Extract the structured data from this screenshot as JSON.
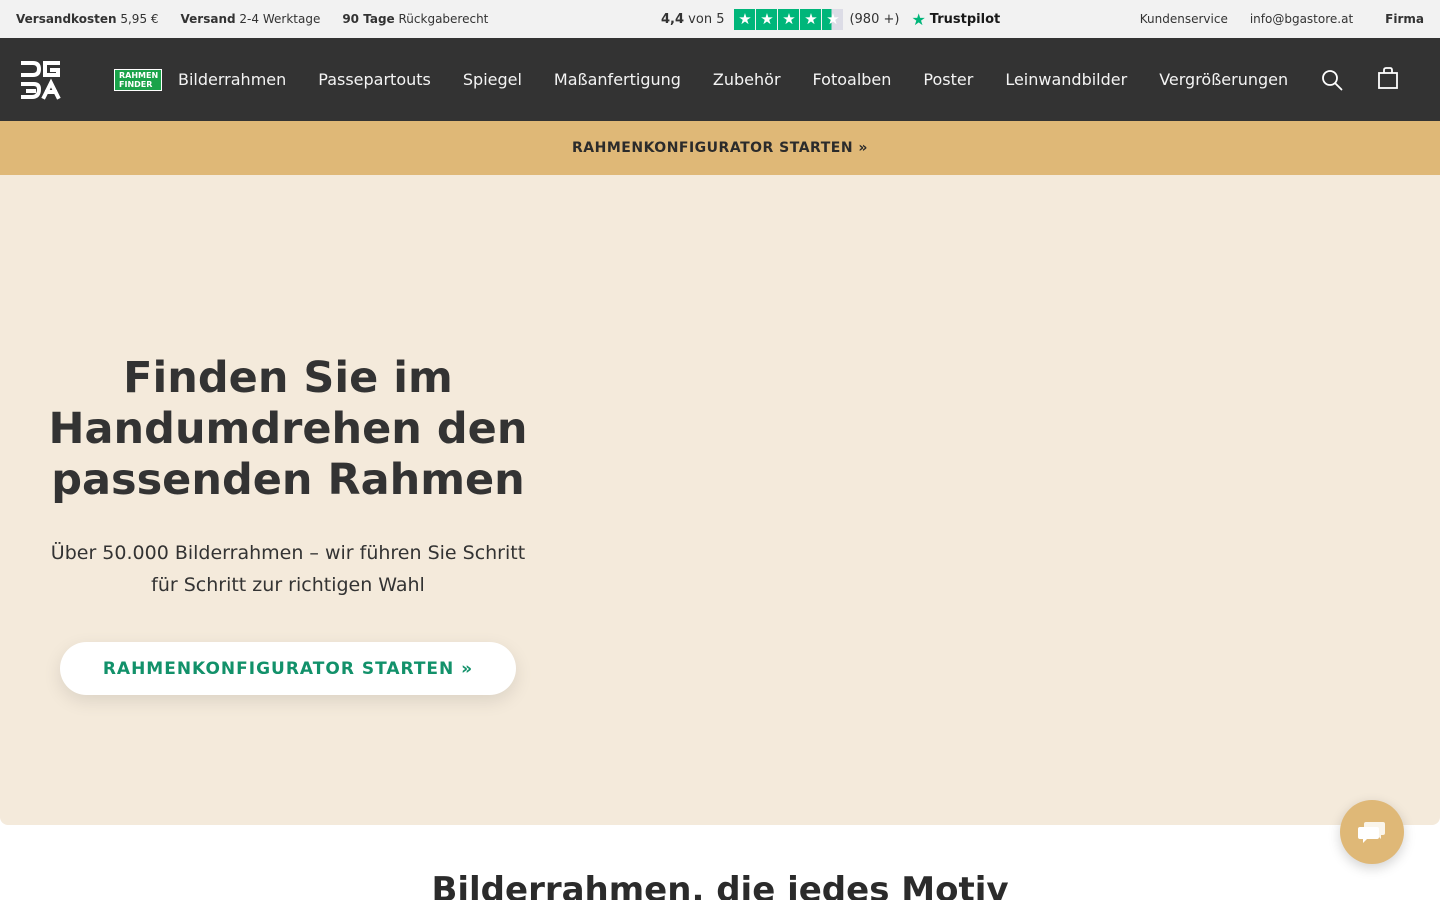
{
  "topbar": {
    "shipping_cost_label": "Versandkosten",
    "shipping_cost_value": "5,95 €",
    "delivery_label": "Versand",
    "delivery_value": "2-4 Werktage",
    "returns_label": "90 Tage",
    "returns_value": "Rückgaberecht",
    "rating_score": "4,4",
    "rating_suffix": "von 5",
    "rating_stars": 4.4,
    "rating_count": "(980 +)",
    "trustpilot_label": "Trustpilot",
    "customer_service": "Kundenservice",
    "email": "info@bgastore.at",
    "company": "Firma"
  },
  "nav": {
    "finder_badge_line1": "RAHMEN",
    "finder_badge_line2": "FINDER",
    "items": [
      "Bilderrahmen",
      "Passepartouts",
      "Spiegel",
      "Maßanfertigung",
      "Zubehör",
      "Fotoalben",
      "Poster",
      "Leinwandbilder",
      "Vergrößerungen"
    ],
    "search_icon": "search-icon",
    "cart_icon": "shopping-bag-icon"
  },
  "promo": {
    "label": "RAHMENKONFIGURATOR STARTEN »"
  },
  "hero": {
    "title": "Finden Sie im Handumdrehen den passenden Rahmen",
    "subtitle": "Über 50.000 Bilderrahmen – wir führen Sie Schritt für Schritt zur richtigen Wahl",
    "cta": "RAHMENKONFIGURATOR STARTEN »"
  },
  "section": {
    "title": "Bilderrahmen, die jedes Motiv"
  },
  "chat": {
    "icon": "chat-icon"
  },
  "colors": {
    "nav_bg": "#333333",
    "promo_bg": "#dfb877",
    "hero_bg": "#f4eadb",
    "cta_text": "#12916a",
    "trustpilot_green": "#00b67a"
  }
}
